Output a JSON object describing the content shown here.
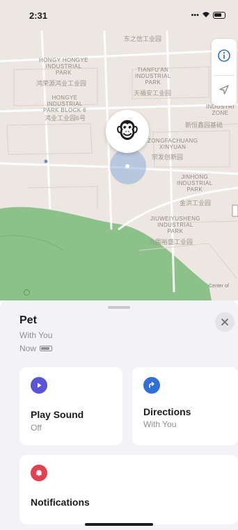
{
  "status_bar": {
    "time": "2:31"
  },
  "map": {
    "labels": [
      {
        "id": "industrial-1",
        "text": "HONGY HONGYE\nINDUSTRIAL\nPARK"
      },
      {
        "id": "industrial-1-cn",
        "text": "鸿荣源鸿业工业园"
      },
      {
        "id": "industrial-2",
        "text": "HONGYE\nINDUSTRIAL\nPARK BLOCK 6"
      },
      {
        "id": "industrial-2-cn",
        "text": "鸿业工业园6号"
      },
      {
        "id": "tianfuan",
        "text": "TIANFU'AN\nINDUSTRIAL\nPARK"
      },
      {
        "id": "tianfuan-cn",
        "text": "天福安工业园"
      },
      {
        "id": "top-cn",
        "text": "东之信工业园"
      },
      {
        "id": "yufu",
        "text": "YUFU\nINDUSTRI\nZONE"
      },
      {
        "id": "yufu-cn",
        "text": "新恒鑫园基础"
      },
      {
        "id": "zongfa",
        "text": "ZONGFACHUANG\nXINYUAN"
      },
      {
        "id": "zongfa-cn",
        "text": "宗发创新园"
      },
      {
        "id": "jinhong",
        "text": "JINHONG\nINDUSTRIAL\nPARK"
      },
      {
        "id": "jinhong-cn",
        "text": "金洪工业园"
      },
      {
        "id": "jiuwei",
        "text": "JIUWEIYUSHENG\nINDUSTRIAL\nPARK"
      },
      {
        "id": "jiuwei-cn",
        "text": "九围裕盛工业园"
      },
      {
        "id": "legal",
        "text": "Center of"
      }
    ]
  },
  "sheet": {
    "title": "Pet",
    "subtitle": "With You",
    "status": "Now",
    "cards": {
      "play_sound": {
        "title": "Play Sound",
        "sub": "Off"
      },
      "directions": {
        "title": "Directions",
        "sub": "With You"
      },
      "notifications": {
        "title": "Notifications"
      }
    }
  },
  "colors": {
    "play_sound_icon": "#5856d6",
    "directions_icon": "#2f6fd6",
    "notifications_icon": "#e5404f",
    "park_green": "#8cc28a"
  },
  "icons": {
    "info": "info-icon",
    "location": "location-arrow-icon",
    "pet": "monkey-icon",
    "close": "close-icon",
    "play": "play-icon",
    "directions": "directions-arrow-icon",
    "bell": "bell-icon"
  }
}
